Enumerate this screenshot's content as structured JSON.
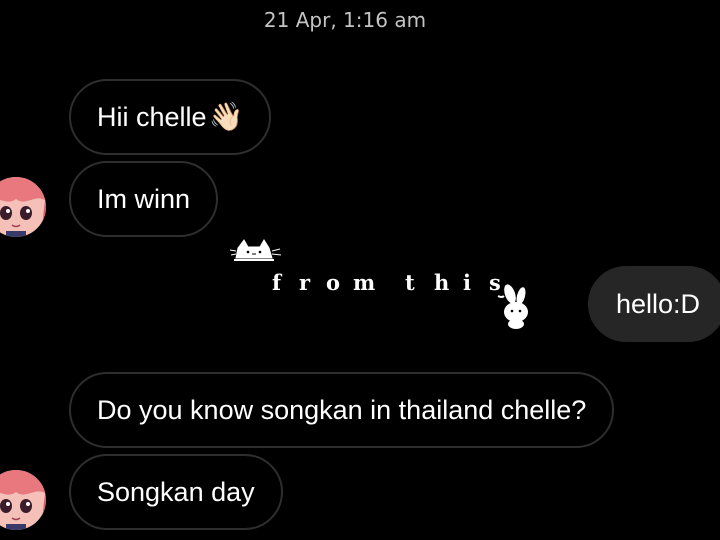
{
  "timestamp": "21 Apr, 1:16 am",
  "messages": [
    {
      "text": "Hii chelle",
      "emoji": "👋🏻"
    },
    {
      "text": "Im winn"
    },
    {
      "text": "hello:D"
    },
    {
      "text": "Do you know songkan in thailand chelle?"
    },
    {
      "text": "Songkan day"
    }
  ],
  "overlay": {
    "chars": [
      "f",
      "r",
      "o",
      "m",
      "t",
      "h",
      "i",
      "s"
    ]
  },
  "colors": {
    "background": "#000000",
    "incoming_border": "#2e2e2e",
    "outgoing_bubble": "#262626",
    "timestamp": "#c4c4c4",
    "avatar_hair": "#e8787e"
  },
  "icons": {
    "avatar": "anime-avatar-icon",
    "sticker_left": "cat-sticker-icon",
    "sticker_right": "bunny-sticker-icon"
  }
}
